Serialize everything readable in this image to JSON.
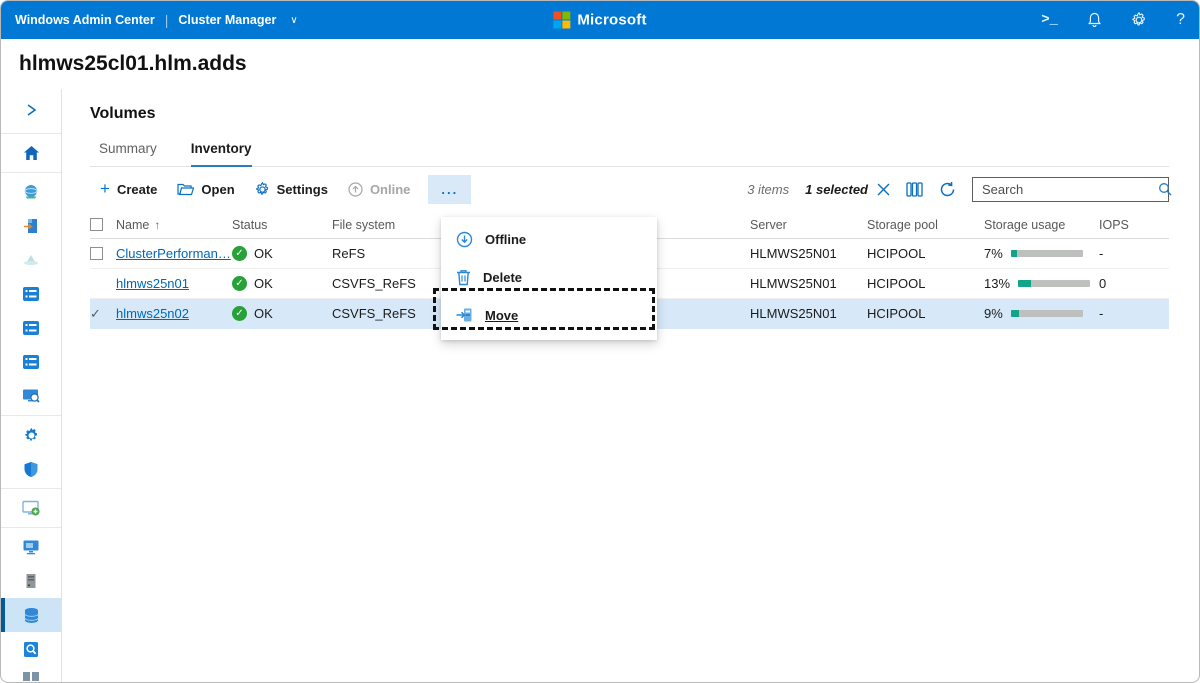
{
  "topbar": {
    "app_name": "Windows Admin Center",
    "separator": "|",
    "solution_name": "Cluster Manager",
    "solution_chevron": "∨",
    "logo_text": "Microsoft",
    "icons": [
      "powershell-icon",
      "notifications-bell-icon",
      "settings-gear-icon",
      "help-icon"
    ],
    "help_glyph": "?",
    "powershell_glyph": ">_"
  },
  "page": {
    "title": "hlmws25cl01.hlm.adds"
  },
  "sidebar": {
    "selected_item": "volumes",
    "items": [
      "expand-chevron",
      "home",
      "cluster-overview",
      "azure-hybrid",
      "drives-faint",
      "servers-grid-1",
      "servers-grid-2",
      "servers-grid-3",
      "diagnostics",
      "settings",
      "security",
      "extensions",
      "remote-monitor",
      "server-tower",
      "volumes",
      "storage-search",
      "partial-bottom"
    ]
  },
  "main": {
    "heading": "Volumes",
    "tabs": [
      {
        "label": "Summary",
        "active": false
      },
      {
        "label": "Inventory",
        "active": true
      }
    ],
    "toolbar": {
      "create_label": "Create",
      "open_label": "Open",
      "settings_label": "Settings",
      "online_label": "Online",
      "more_label": "...",
      "items_count": "3 items",
      "selected_count": "1 selected",
      "search_placeholder": "Search"
    },
    "table": {
      "headers": {
        "name": "Name",
        "sort_arrow": "↑",
        "status": "Status",
        "file_system": "File system",
        "server": "Server",
        "storage_pool": "Storage pool",
        "storage_usage": "Storage usage",
        "iops": "IOPS"
      },
      "rows": [
        {
          "name": "ClusterPerforman…",
          "status": "OK",
          "file_system": "ReFS",
          "server": "HLMWS25N01",
          "storage_pool": "HCIPOOL",
          "usage_label": "7%",
          "usage_pct": 9,
          "iops": "-",
          "selected": false
        },
        {
          "name": "hlmws25n01",
          "status": "OK",
          "file_system": "CSVFS_ReFS",
          "server": "HLMWS25N01",
          "storage_pool": "HCIPOOL",
          "usage_label": "13%",
          "usage_pct": 18,
          "iops": "0",
          "selected": false
        },
        {
          "name": "hlmws25n02",
          "status": "OK",
          "file_system": "CSVFS_ReFS",
          "server": "HLMWS25N01",
          "storage_pool": "HCIPOOL",
          "usage_label": "9%",
          "usage_pct": 11,
          "iops": "-",
          "selected": true
        }
      ],
      "ok_check_glyph": "✓",
      "row_selected_check_glyph": "✓"
    },
    "context_menu": {
      "items": [
        {
          "label": "Offline",
          "icon": "offline-icon",
          "highlighted": false
        },
        {
          "label": "Delete",
          "icon": "delete-icon",
          "highlighted": false
        },
        {
          "label": "Move",
          "icon": "move-icon",
          "highlighted": true
        }
      ]
    }
  },
  "colors": {
    "brand_blue": "#0078d4",
    "sidebar_selected_bg": "#cde4f6",
    "sidebar_selected_bar": "#005a9e",
    "row_selected_bg": "#d7e9f9",
    "link_blue": "#0067b8",
    "status_ok_green": "#28a138",
    "usage_fill_teal": "#12a489",
    "usage_track_gray": "#bdc0bc",
    "ms_logo_red": "#f25022",
    "ms_logo_green": "#7fba00",
    "ms_logo_blue": "#00a4ef",
    "ms_logo_yellow": "#ffb900"
  }
}
